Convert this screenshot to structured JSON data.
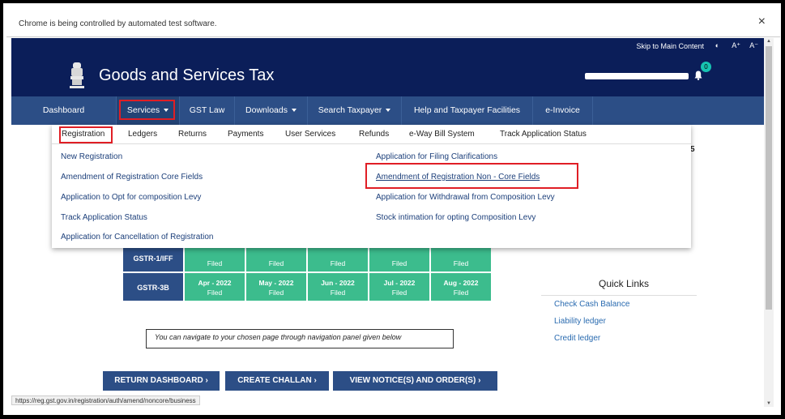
{
  "browser": {
    "infobar_text": "Chrome is being controlled by automated test software.",
    "close_label": "×",
    "status_url": "https://reg.gst.gov.in/registration/auth/amend/noncore/business"
  },
  "header": {
    "skip_link": "Skip to Main Content",
    "contrast_icon": "◐",
    "font_increase": "A⁺",
    "font_decrease": "A⁻",
    "site_title": "Goods and Services Tax",
    "notification_count": "0"
  },
  "main_nav": [
    {
      "label": "Dashboard"
    },
    {
      "label": "Services"
    },
    {
      "label": "GST Law"
    },
    {
      "label": "Downloads"
    },
    {
      "label": "Search Taxpayer"
    },
    {
      "label": "Help and Taxpayer Facilities"
    },
    {
      "label": "e-Invoice"
    }
  ],
  "services_subnav": [
    {
      "label": "Registration"
    },
    {
      "label": "Ledgers"
    },
    {
      "label": "Returns"
    },
    {
      "label": "Payments"
    },
    {
      "label": "User Services"
    },
    {
      "label": "Refunds"
    },
    {
      "label": "e-Way Bill System"
    },
    {
      "label": "Track Application Status"
    }
  ],
  "registration_links_left": [
    "New Registration",
    "Amendment of Registration Core Fields",
    "Application to Opt for composition Levy",
    "Track Application Status",
    "Application for Cancellation of Registration"
  ],
  "registration_links_right": [
    "Application for Filing Clarifications",
    "Amendment of Registration Non - Core Fields",
    "Application for Withdrawal from Composition Levy",
    "Stock intimation for opting Composition Levy"
  ],
  "partial_digit": "5",
  "returns_table": {
    "row1_label": "GSTR-1/IFF",
    "row1_status": "Filed",
    "row2_label": "GSTR-3B",
    "row2": [
      {
        "period": "Apr - 2022",
        "status": "Filed"
      },
      {
        "period": "May - 2022",
        "status": "Filed"
      },
      {
        "period": "Jun - 2022",
        "status": "Filed"
      },
      {
        "period": "Jul - 2022",
        "status": "Filed"
      },
      {
        "period": "Aug - 2022",
        "status": "Filed"
      }
    ]
  },
  "quick_links": {
    "title": "Quick Links",
    "items": [
      "Check Cash Balance",
      "Liability ledger",
      "Credit ledger"
    ]
  },
  "nav_note": "You can navigate to your chosen page through navigation panel given below",
  "buttons": {
    "return_dashboard": "RETURN DASHBOARD ›",
    "create_challan": "CREATE CHALLAN ›",
    "view_notices": "VIEW NOTICE(S) AND ORDER(S) ›"
  },
  "colors": {
    "header_navy": "#0b1e59",
    "nav_blue": "#2c4e86",
    "filed_green": "#3cbc8d",
    "highlight_red": "#e01e25",
    "link_blue": "#1c3f7a"
  }
}
